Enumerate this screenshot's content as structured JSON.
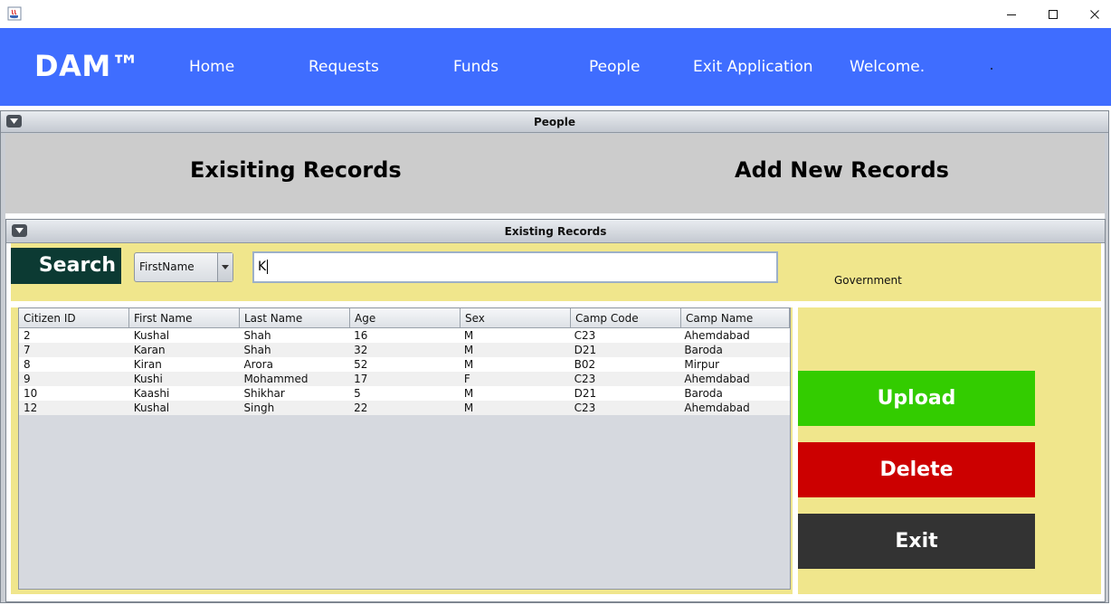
{
  "window": {
    "controls": {
      "minimize": "—",
      "maximize": "☐",
      "close": "✕"
    }
  },
  "nav": {
    "brand": "DAM™",
    "items": [
      {
        "label": "Home"
      },
      {
        "label": "Requests"
      },
      {
        "label": "Funds"
      },
      {
        "label": "People"
      },
      {
        "label": "Exit Application"
      },
      {
        "label": "Welcome."
      }
    ]
  },
  "people_frame": {
    "title": "People",
    "tabs": [
      "Exisiting Records",
      "Add New Records"
    ]
  },
  "records_frame": {
    "title": "Existing Records",
    "search": {
      "button_label": "Search",
      "field_selected": "FirstName",
      "query": "K"
    },
    "role_label": "Government",
    "table": {
      "columns": [
        "Citizen ID",
        "First Name",
        "Last Name",
        "Age",
        "Sex",
        "Camp Code",
        "Camp Name"
      ],
      "rows": [
        [
          "2",
          "Kushal",
          "Shah",
          "16",
          "M",
          "C23",
          "Ahemdabad"
        ],
        [
          "7",
          "Karan",
          "Shah",
          "32",
          "M",
          "D21",
          "Baroda"
        ],
        [
          "8",
          "Kiran",
          "Arora",
          "52",
          "M",
          "B02",
          "Mirpur"
        ],
        [
          "9",
          "Kushi",
          "Mohammed",
          "17",
          "F",
          "C23",
          "Ahemdabad"
        ],
        [
          "10",
          "Kaashi",
          "Shikhar",
          "5",
          "M",
          "D21",
          "Baroda"
        ],
        [
          "12",
          "Kushal",
          "Singh",
          "22",
          "M",
          "C23",
          "Ahemdabad"
        ]
      ]
    },
    "actions": {
      "upload": "Upload",
      "delete": "Delete",
      "exit": "Exit"
    }
  },
  "colors": {
    "nav_bg": "#3f6dff",
    "panel_yellow": "#f0e68c",
    "search_bg": "#0c3a33",
    "upload": "#33cc00",
    "delete": "#cc0000",
    "exit": "#333333"
  }
}
